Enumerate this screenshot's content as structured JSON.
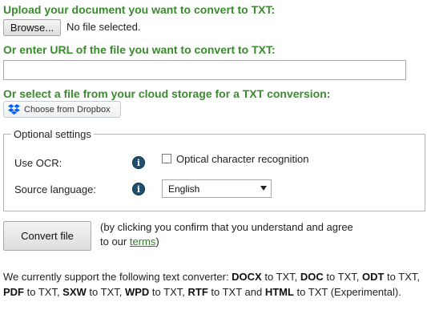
{
  "upload": {
    "heading": "Upload your document you want to convert to TXT:",
    "browse_label": "Browse...",
    "no_file": "No file selected."
  },
  "url": {
    "heading": "Or enter URL of the file you want to convert to TXT:",
    "value": "",
    "placeholder": ""
  },
  "cloud": {
    "heading": "Or select a file from your cloud storage for a TXT conversion:",
    "dropbox_label": "Choose from Dropbox",
    "dropbox_icon": "dropbox-icon"
  },
  "optional": {
    "legend": "Optional settings",
    "ocr_label": "Use OCR:",
    "ocr_checkbox_label": "Optical character recognition",
    "ocr_checked": false,
    "language_label": "Source language:",
    "language_selected": "English",
    "info_icon_glyph": "i"
  },
  "convert": {
    "button_label": "Convert file",
    "confirm_prefix": "(by clicking you confirm that you understand and agree to our ",
    "terms_link": "terms",
    "confirm_suffix": ")"
  },
  "support": {
    "intro": "We currently support the following text converter: ",
    "items": [
      {
        "format": "DOCX",
        "suffix": " to TXT, "
      },
      {
        "format": "DOC",
        "suffix": " to TXT, "
      },
      {
        "format": "ODT",
        "suffix": " to TXT, "
      },
      {
        "format": "PDF",
        "suffix": " to TXT, "
      },
      {
        "format": "SXW",
        "suffix": " to TXT, "
      },
      {
        "format": "WPD",
        "suffix": " to TXT, "
      },
      {
        "format": "RTF",
        "suffix": " to TXT and "
      },
      {
        "format": "HTML",
        "suffix": " to TXT (Experimental)."
      }
    ]
  },
  "colors": {
    "heading_green": "#3a8a2e",
    "link_green": "#2e7d25",
    "info_icon_blue": "#1f4f6e",
    "dropbox_blue": "#0061fe"
  }
}
